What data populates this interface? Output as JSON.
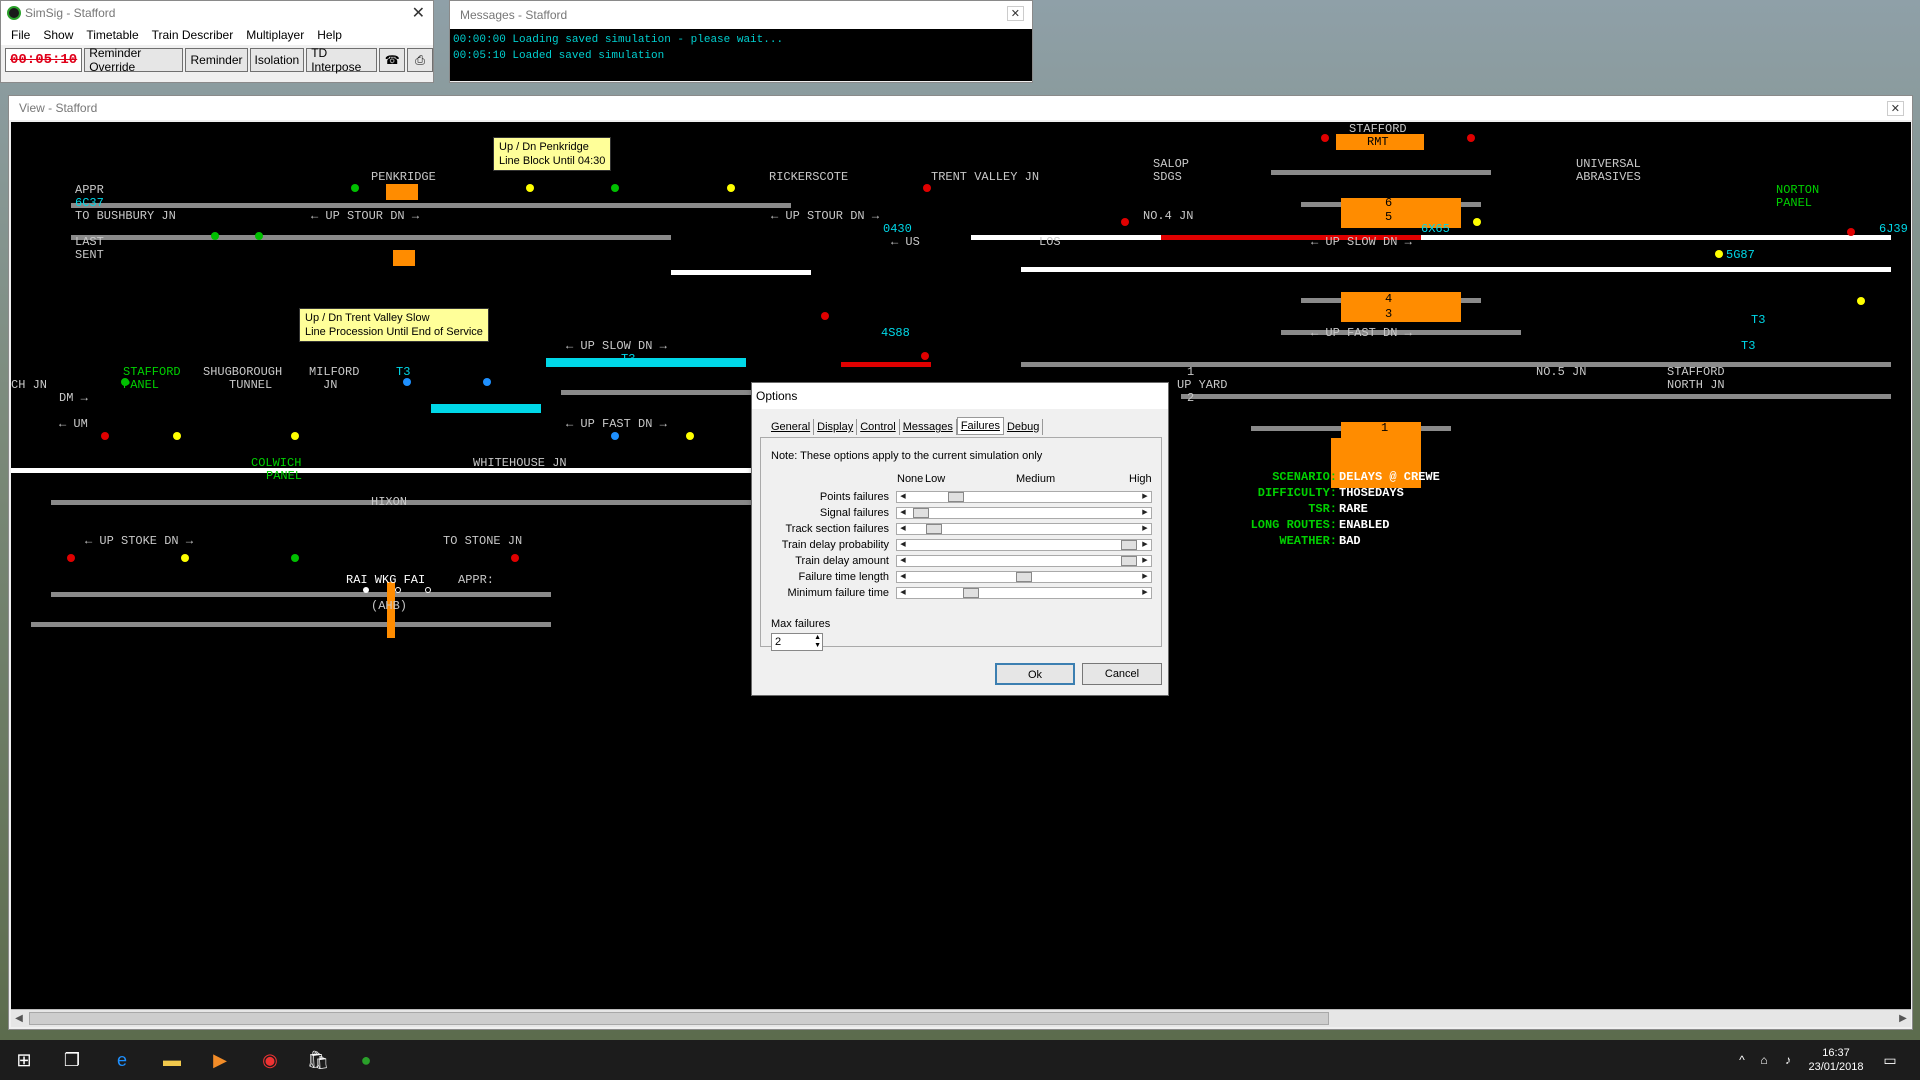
{
  "simsig": {
    "title": "SimSig - Stafford",
    "menu": [
      "File",
      "Show",
      "Timetable",
      "Train Describer",
      "Multiplayer",
      "Help"
    ],
    "clock": "00:05:10",
    "buttons": [
      "Reminder Override",
      "Reminder",
      "Isolation",
      "TD Interpose"
    ]
  },
  "messages": {
    "title": "Messages - Stafford",
    "lines": [
      "00:00:00 Loading saved simulation - please wait...",
      "00:05:10 Loaded saved simulation"
    ]
  },
  "view": {
    "title": "View - Stafford",
    "notes": {
      "penkridge": [
        "Up / Dn Penkridge",
        "Line Block Until 04:30"
      ],
      "trent": [
        "Up / Dn Trent Valley Slow",
        "Line Procession Until End of Service"
      ]
    },
    "labels": {
      "appr": "APPR",
      "bushbury": "TO BUSHBURY JN",
      "last": "LAST",
      "sent": "SENT",
      "penkridge": "PENKRIDGE",
      "up_stour_1": "← UP STOUR DN →",
      "rickerscote": "RICKERSCOTE",
      "up_stour_2": "← UP STOUR DN →",
      "trent_valley_jn": "TRENT VALLEY JN",
      "us": "← US",
      "los": "LOS",
      "salop": "SALOP",
      "sdgs": "SDGS",
      "no4jn": "NO.4 JN",
      "stafford": "STAFFORD",
      "rmt": "RMT",
      "universal": "UNIVERSAL",
      "abrasives": "ABRASIVES",
      "norton": "NORTON",
      "panel": "PANEL",
      "up_slow_main": "← UP SLOW DN →",
      "up_fast_main": "← UP FAST DN →",
      "up_slow_left": "← UP SLOW DN →",
      "up_fast_left": "← UP FAST DN →",
      "ch_jn": "CH JN",
      "stafford_panel_1": "STAFFORD",
      "stafford_panel_2": "PANEL",
      "shugborough": "SHUGBOROUGH",
      "tunnel": "TUNNEL",
      "milford": "MILFORD",
      "jn": "JN",
      "dm": "DM →",
      "um": "← UM",
      "colwich": "COLWICH",
      "colwich_panel": "PANEL",
      "whitehouse": "WHITEHOUSE JN",
      "hixon": "HIXON",
      "up_stoke": "← UP STOKE DN →",
      "to_stone": "TO STONE JN",
      "rai_wkg_fai": "RAI WKG FAI",
      "appr2": "APPR:",
      "ahb": "(AHB)",
      "no5jn": "NO.5 JN",
      "stafford_north": "STAFFORD",
      "north_jn": "NORTH JN",
      "up_yard_1": "1",
      "up_yard": "UP YARD",
      "up_yard_2": "2"
    },
    "berths": {
      "6c37": "6C37",
      "0430": "0430",
      "6x65": "6X65",
      "5g87": "5G87",
      "4s88": "4S88",
      "6j39": "6J39",
      "t3": "T3"
    },
    "platforms": [
      "6",
      "5",
      "4",
      "3",
      "1"
    ],
    "scenario": {
      "keys": [
        "SCENARIO:",
        "DIFFICULTY:",
        "TSR:",
        "LONG ROUTES:",
        "WEATHER:"
      ],
      "values": [
        "DELAYS @ CREWE",
        "THOSEDAYS",
        "RARE",
        "ENABLED",
        "BAD"
      ]
    }
  },
  "options_dialog": {
    "title": "Options",
    "tabs": [
      "General",
      "Display",
      "Control",
      "Messages",
      "Failures",
      "Debug"
    ],
    "active_tab": "Failures",
    "note": "Note: These options apply to the current simulation only",
    "scale": [
      "None",
      "Low",
      "Medium",
      "High"
    ],
    "sliders": [
      {
        "label": "Points failures",
        "level": 0.18
      },
      {
        "label": "Signal failures",
        "level": 0.02
      },
      {
        "label": "Track section failures",
        "level": 0.08
      },
      {
        "label": "Train delay probability",
        "level": 0.99
      },
      {
        "label": "Train delay amount",
        "level": 0.99
      },
      {
        "label": "Failure time length",
        "level": 0.5
      },
      {
        "label": "Minimum failure time",
        "level": 0.25
      }
    ],
    "max_failures_label": "Max failures",
    "max_failures": "2",
    "ok": "Ok",
    "cancel": "Cancel"
  },
  "taskbar": {
    "time": "16:37",
    "date": "23/01/2018"
  }
}
